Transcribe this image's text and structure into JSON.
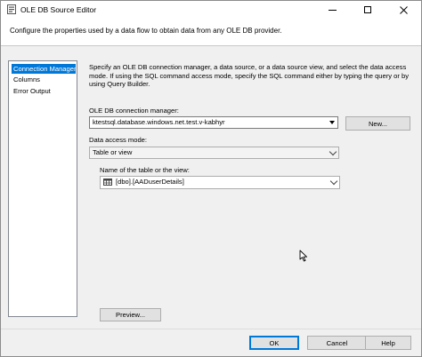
{
  "window": {
    "title": "OLE DB Source Editor",
    "description": "Configure the properties used by a data flow to obtain data from any OLE DB provider."
  },
  "nav": {
    "items": [
      {
        "label": "Connection Manager",
        "selected": true
      },
      {
        "label": "Columns",
        "selected": false
      },
      {
        "label": "Error Output",
        "selected": false
      }
    ]
  },
  "panel": {
    "info_line1": "Specify an OLE DB connection manager, a data source, or a data source view, and select the data access",
    "info_line2": "mode. If using the SQL command access mode, specify the SQL command either by typing the query or by",
    "info_line3": "using Query Builder.",
    "connection_label": "OLE DB connection manager:",
    "connection_value": "ktestsql.database.windows.net.test.v-kabhyr",
    "new_button": "New...",
    "access_mode_label": "Data access mode:",
    "access_mode_value": "Table or view",
    "table_label": "Name of the table or the view:",
    "table_value": "[dbo].[AADuserDetails]",
    "preview_button": "Preview..."
  },
  "footer": {
    "ok": "OK",
    "cancel": "Cancel",
    "help": "Help"
  },
  "colors": {
    "selection": "#0078d7",
    "panel_background": "#f0f0f0"
  }
}
